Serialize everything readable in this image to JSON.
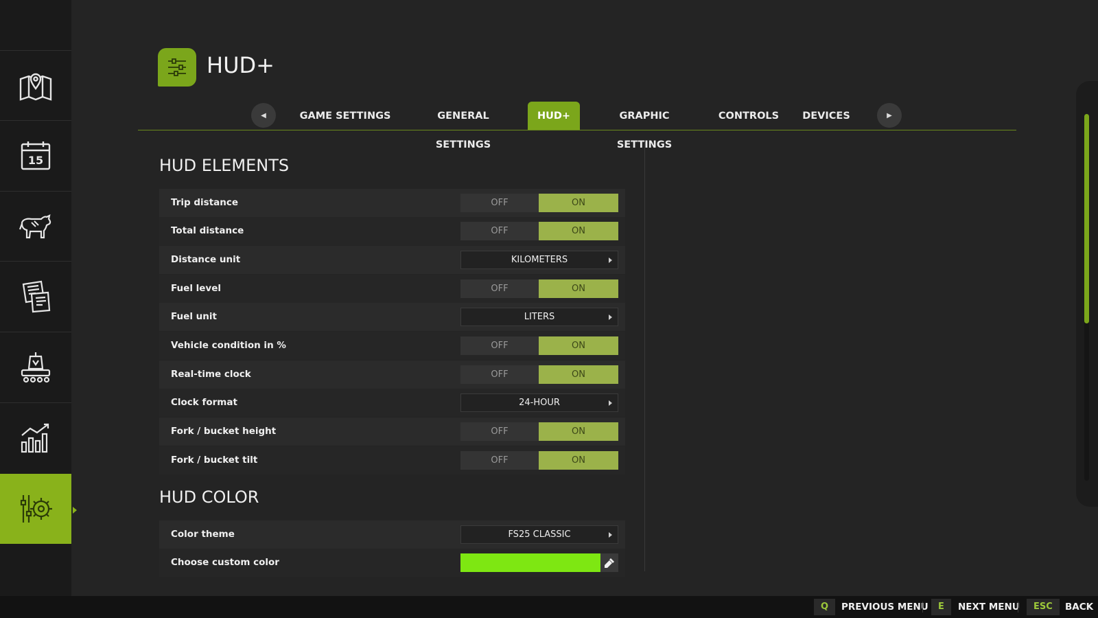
{
  "header": {
    "title": "HUD+",
    "logo_icon": "sliders-icon",
    "accent_color": "#7ba61b"
  },
  "sidebar": {
    "items": [
      {
        "icon": "map-icon",
        "active": false
      },
      {
        "icon": "calendar-icon",
        "day": "15",
        "active": false
      },
      {
        "icon": "cow-icon",
        "active": false
      },
      {
        "icon": "contracts-icon",
        "active": false
      },
      {
        "icon": "production-icon",
        "active": false
      },
      {
        "icon": "statistics-icon",
        "active": false
      },
      {
        "icon": "settings-icon",
        "active": true
      }
    ]
  },
  "tabs": {
    "prev_icon": "arrow-left-icon",
    "next_icon": "arrow-right-icon",
    "items": [
      {
        "label": "GAME SETTINGS",
        "active": false
      },
      {
        "label": "GENERAL SETTINGS",
        "active": false
      },
      {
        "label": "HUD+",
        "active": true
      },
      {
        "label": "GRAPHIC SETTINGS",
        "active": false
      },
      {
        "label": "CONTROLS",
        "active": false
      },
      {
        "label": "DEVICES",
        "active": false
      }
    ]
  },
  "hud_elements": {
    "title": "HUD ELEMENTS",
    "rows": [
      {
        "label": "Trip distance",
        "type": "toggle",
        "off": "OFF",
        "on": "ON",
        "value": "ON"
      },
      {
        "label": "Total distance",
        "type": "toggle",
        "off": "OFF",
        "on": "ON",
        "value": "ON"
      },
      {
        "label": "Distance unit",
        "type": "select",
        "value": "KILOMETERS"
      },
      {
        "label": "Fuel level",
        "type": "toggle",
        "off": "OFF",
        "on": "ON",
        "value": "ON"
      },
      {
        "label": "Fuel unit",
        "type": "select",
        "value": "LITERS"
      },
      {
        "label": "Vehicle condition in %",
        "type": "toggle",
        "off": "OFF",
        "on": "ON",
        "value": "ON"
      },
      {
        "label": "Real-time clock",
        "type": "toggle",
        "off": "OFF",
        "on": "ON",
        "value": "ON"
      },
      {
        "label": "Clock format",
        "type": "select",
        "value": "24-HOUR"
      },
      {
        "label": "Fork / bucket height",
        "type": "toggle",
        "off": "OFF",
        "on": "ON",
        "value": "ON"
      },
      {
        "label": "Fork / bucket tilt",
        "type": "toggle",
        "off": "OFF",
        "on": "ON",
        "value": "ON"
      }
    ]
  },
  "hud_color": {
    "title": "HUD COLOR",
    "color_theme": {
      "label": "Color theme",
      "value": "FS25 CLASSIC"
    },
    "custom_color": {
      "label": "Choose custom color",
      "color": "#7ee712",
      "picker_icon": "color-picker-icon"
    }
  },
  "footer": {
    "prev": {
      "key": "Q",
      "label": "PREVIOUS MENU"
    },
    "next": {
      "key": "E",
      "label": "NEXT MENU"
    },
    "back": {
      "key": "ESC",
      "label": "BACK"
    }
  }
}
